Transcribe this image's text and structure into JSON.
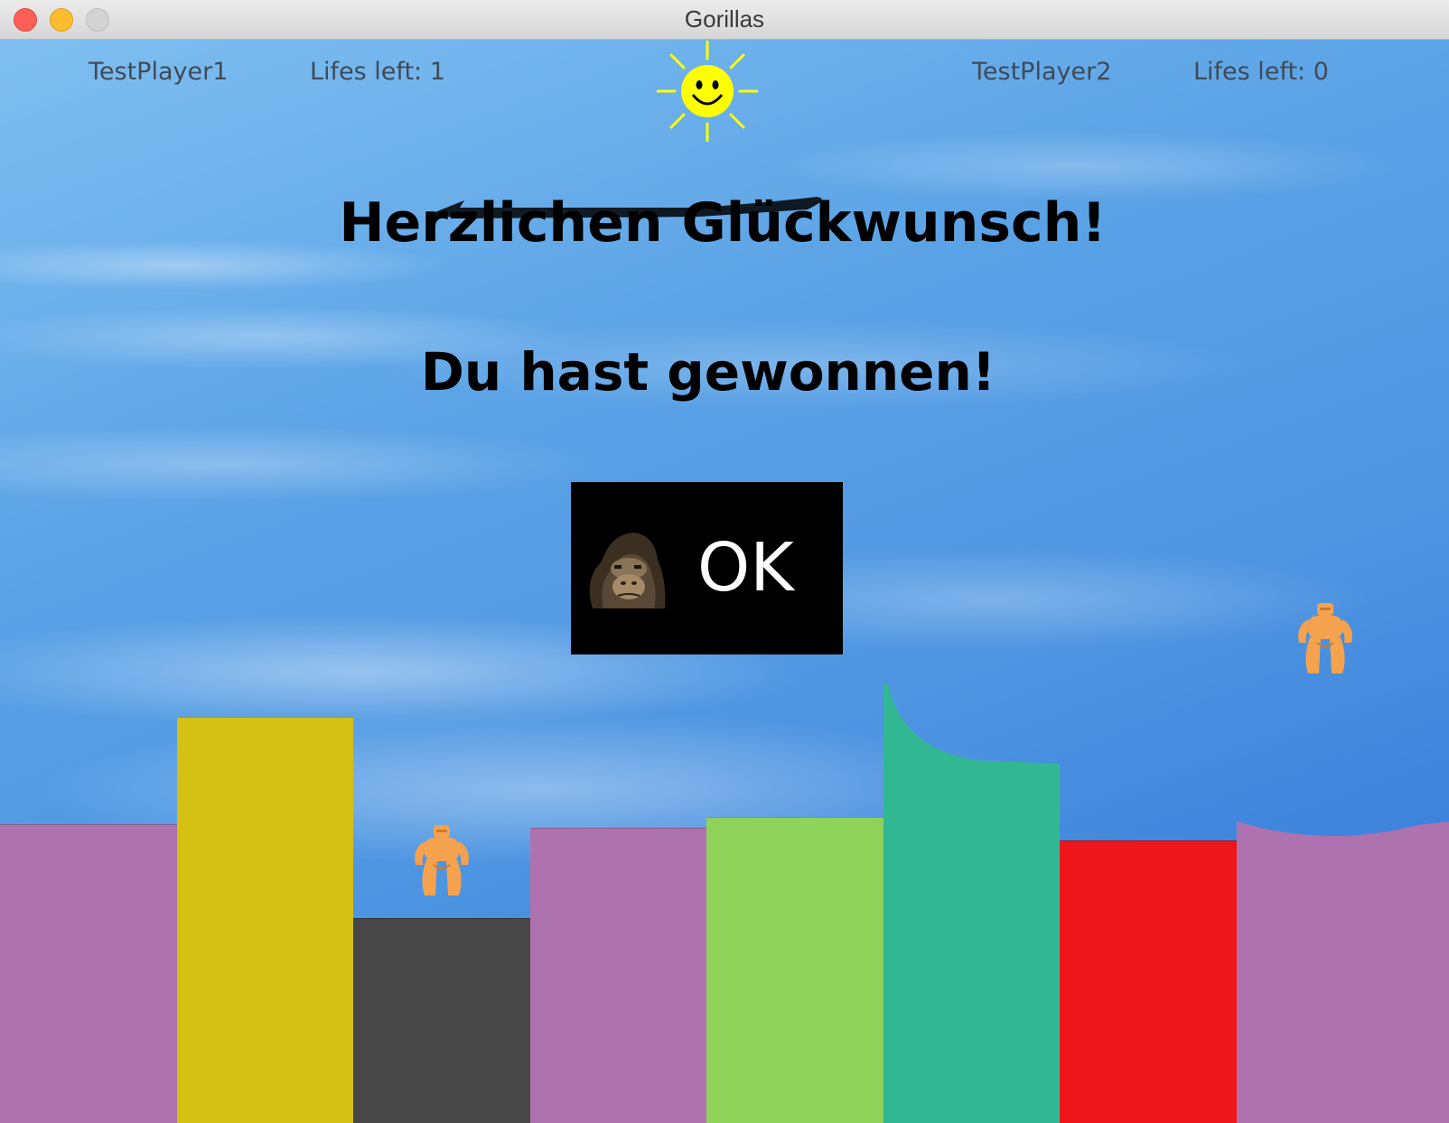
{
  "window": {
    "title": "Gorillas"
  },
  "hud": {
    "player1": {
      "name": "TestPlayer1",
      "lifes_text": "Lifes left: 1"
    },
    "player2": {
      "name": "TestPlayer2",
      "lifes_text": "Lifes left: 0"
    }
  },
  "messages": {
    "congratulations": "Herzlichen Glückwunsch!",
    "won": "Du hast gewonnen!"
  },
  "dialog": {
    "ok_label": "OK",
    "icon": "gorilla-face-icon"
  },
  "sun": {
    "icon": "smiling-sun-icon"
  },
  "skyline": {
    "buildings": [
      {
        "name": "building-1",
        "color": "#ae72ae"
      },
      {
        "name": "building-2",
        "color": "#d5c014"
      },
      {
        "name": "building-3",
        "color": "#474747"
      },
      {
        "name": "building-4",
        "color": "#ae72ae"
      },
      {
        "name": "building-5",
        "color": "#8ed25a"
      },
      {
        "name": "building-6",
        "color": "#31b893"
      },
      {
        "name": "building-7",
        "color": "#ee161b"
      },
      {
        "name": "building-8",
        "color": "#ae72ae"
      }
    ]
  },
  "colors": {
    "gorilla": "#f4a24e",
    "sun": "#ffff00"
  }
}
